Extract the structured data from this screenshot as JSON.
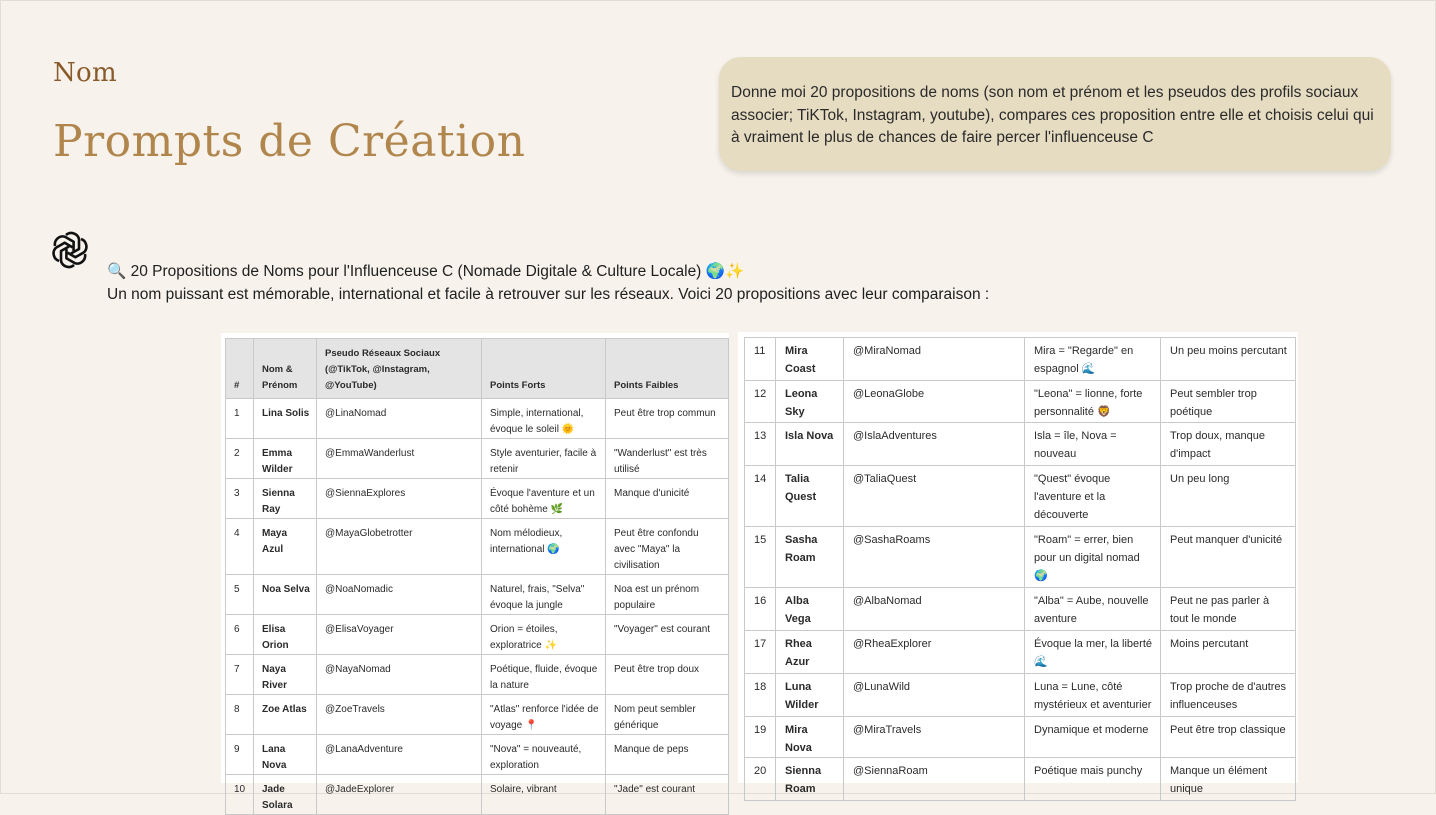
{
  "page": {
    "kicker": "Nom",
    "title": "Prompts de Création"
  },
  "prompt": {
    "text": "Donne moi 20 propositions de noms (son nom et prénom et les pseudos des profils sociaux associer; TiKTok, Instagram, youtube), compares ces proposition entre elle et choisis celui qui à vraiment le plus de chances de faire percer l'influenceuse C"
  },
  "response": {
    "heading_icon": "🔍",
    "heading": "20 Propositions de Noms pour l'Influenceuse C (Nomade Digitale & Culture Locale)",
    "heading_emojis": "🌍✨",
    "intro": "Un nom puissant est mémorable, international et facile à retrouver sur les réseaux. Voici 20 propositions avec leur comparaison :"
  },
  "table": {
    "headers": [
      "#",
      "Nom & Prénom",
      "Pseudo Réseaux Sociaux (@TikTok, @Instagram, @YouTube)",
      "Points Forts",
      "Points Faibles"
    ],
    "rows_left": [
      [
        "1",
        "Lina Solis",
        "@LinaNomad",
        "Simple, international, évoque le soleil 🌞",
        "Peut être trop commun"
      ],
      [
        "2",
        "Emma Wilder",
        "@EmmaWanderlust",
        "Style aventurier, facile à retenir",
        "\"Wanderlust\" est très utilisé"
      ],
      [
        "3",
        "Sienna Ray",
        "@SiennaExplores",
        "Évoque l'aventure et un côté bohème 🌿",
        "Manque d'unicité"
      ],
      [
        "4",
        "Maya Azul",
        "@MayaGlobetrotter",
        "Nom mélodieux, international 🌍",
        "Peut être confondu avec \"Maya\" la civilisation"
      ],
      [
        "5",
        "Noa Selva",
        "@NoaNomadic",
        "Naturel, frais, \"Selva\" évoque la jungle",
        "Noa est un prénom populaire"
      ],
      [
        "6",
        "Elisa Orion",
        "@ElisaVoyager",
        "Orion = étoiles, exploratrice ✨",
        "\"Voyager\" est courant"
      ],
      [
        "7",
        "Naya River",
        "@NayaNomad",
        "Poétique, fluide, évoque la nature",
        "Peut être trop doux"
      ],
      [
        "8",
        "Zoe Atlas",
        "@ZoeTravels",
        "\"Atlas\" renforce l'idée de voyage 📍",
        "Nom peut sembler générique"
      ],
      [
        "9",
        "Lana Nova",
        "@LanaAdventure",
        "\"Nova\" = nouveauté, exploration",
        "Manque de peps"
      ],
      [
        "10",
        "Jade Solara",
        "@JadeExplorer",
        "Solaire, vibrant",
        "\"Jade\" est courant"
      ]
    ],
    "rows_right": [
      [
        "11",
        "Mira Coast",
        "@MiraNomad",
        "Mira = \"Regarde\" en espagnol 🌊",
        "Un peu moins percutant"
      ],
      [
        "12",
        "Leona Sky",
        "@LeonaGlobe",
        "\"Leona\" = lionne, forte personnalité 🦁",
        "Peut sembler trop poétique"
      ],
      [
        "13",
        "Isla Nova",
        "@IslaAdventures",
        "Isla = île, Nova = nouveau",
        "Trop doux, manque d'impact"
      ],
      [
        "14",
        "Talia Quest",
        "@TaliaQuest",
        "\"Quest\" évoque l'aventure et la découverte",
        "Un peu long"
      ],
      [
        "15",
        "Sasha Roam",
        "@SashaRoams",
        "\"Roam\" = errer, bien pour un digital nomad 🌍",
        "Peut manquer d'unicité"
      ],
      [
        "16",
        "Alba Vega",
        "@AlbaNomad",
        "\"Alba\" = Aube, nouvelle aventure",
        "Peut ne pas parler à tout le monde"
      ],
      [
        "17",
        "Rhea Azur",
        "@RheaExplorer",
        "Évoque la mer, la liberté 🌊",
        "Moins percutant"
      ],
      [
        "18",
        "Luna Wilder",
        "@LunaWild",
        "Luna = Lune, côté mystérieux et aventurier",
        "Trop proche de d'autres influenceuses"
      ],
      [
        "19",
        "Mira Nova",
        "@MiraTravels",
        "Dynamique et moderne",
        "Peut être trop classique"
      ],
      [
        "20",
        "Sienna Roam",
        "@SiennaRoam",
        "Poétique mais punchy",
        "Manque un élément unique"
      ]
    ]
  },
  "colors": {
    "background": "#f7f3ec",
    "kicker": "#8a5a2b",
    "title": "#b0864d",
    "bubble": "#e6dcc2"
  },
  "icons": {
    "assistant": "openai-logo-icon"
  }
}
